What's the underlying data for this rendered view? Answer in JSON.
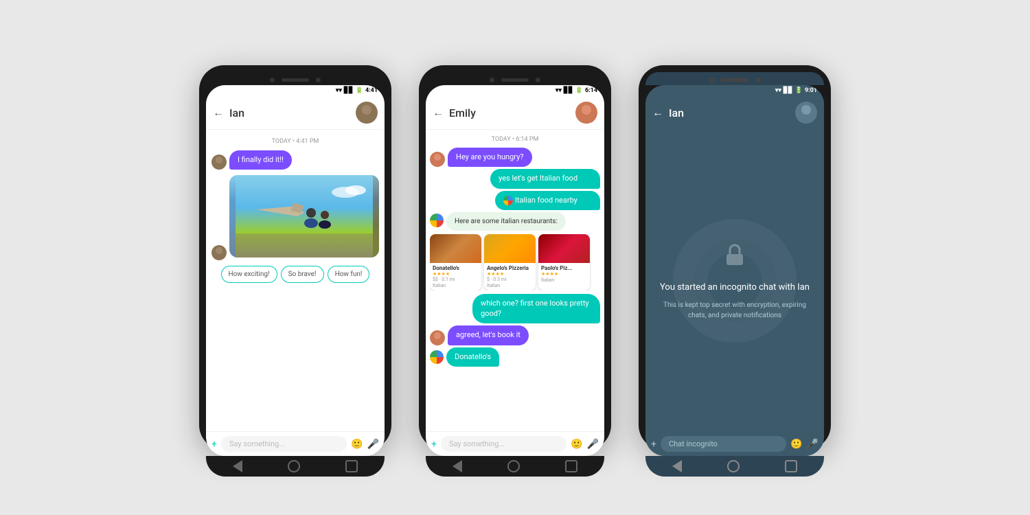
{
  "background_color": "#e8e8e8",
  "phones": [
    {
      "id": "phone1",
      "contact": "Ian",
      "time": "4:41",
      "timestamp_label": "TODAY • 4:41 PM",
      "messages": [
        {
          "type": "received_text",
          "text": "I finally did it!!",
          "bubble_color": "purple"
        },
        {
          "type": "image",
          "alt": "skydiving photo"
        },
        {
          "type": "quick_replies",
          "options": [
            "How exciting!",
            "So brave!",
            "How fun!"
          ]
        }
      ],
      "input_placeholder": "Say something..."
    },
    {
      "id": "phone2",
      "contact": "Emily",
      "time": "6:14",
      "timestamp_label": "TODAY • 6:14 PM",
      "messages": [
        {
          "type": "received_text",
          "text": "Hey are you hungry?",
          "bubble_color": "purple"
        },
        {
          "type": "sent_text",
          "text": "yes let's get Italian food",
          "bubble_color": "teal"
        },
        {
          "type": "sent_text",
          "text": "Italian food nearby",
          "bubble_color": "teal",
          "has_assistant_icon": true
        },
        {
          "type": "assistant_text",
          "text": "Here are some italian restaurants:"
        },
        {
          "type": "restaurant_cards",
          "cards": [
            {
              "name": "Donatello's",
              "stars": "★★★★",
              "price": "$$",
              "distance": "0.1 mi",
              "type": "Italian"
            },
            {
              "name": "Angelo's Pizzeria",
              "stars": "★★★★",
              "price": "$",
              "distance": "0.3 mi",
              "type": "Italian"
            },
            {
              "name": "Paolo's Piz...",
              "stars": "★★★★",
              "price": "",
              "distance": "",
              "type": "Italian"
            }
          ]
        },
        {
          "type": "sent_text",
          "text": "which one? first one looks pretty good?",
          "bubble_color": "teal"
        },
        {
          "type": "received_text",
          "text": "agreed, let's book it",
          "bubble_color": "purple"
        },
        {
          "type": "assistant_donatello",
          "text": "Donatello's"
        }
      ],
      "input_placeholder": "Say something..."
    },
    {
      "id": "phone3",
      "contact": "Ian",
      "time": "9:01",
      "timestamp_label": "",
      "incognito": true,
      "incognito_title": "You started an incognito chat with Ian",
      "incognito_subtitle": "This is kept top secret with encryption, expiring chats, and private notifications",
      "input_placeholder": "Chat incognito"
    }
  ]
}
